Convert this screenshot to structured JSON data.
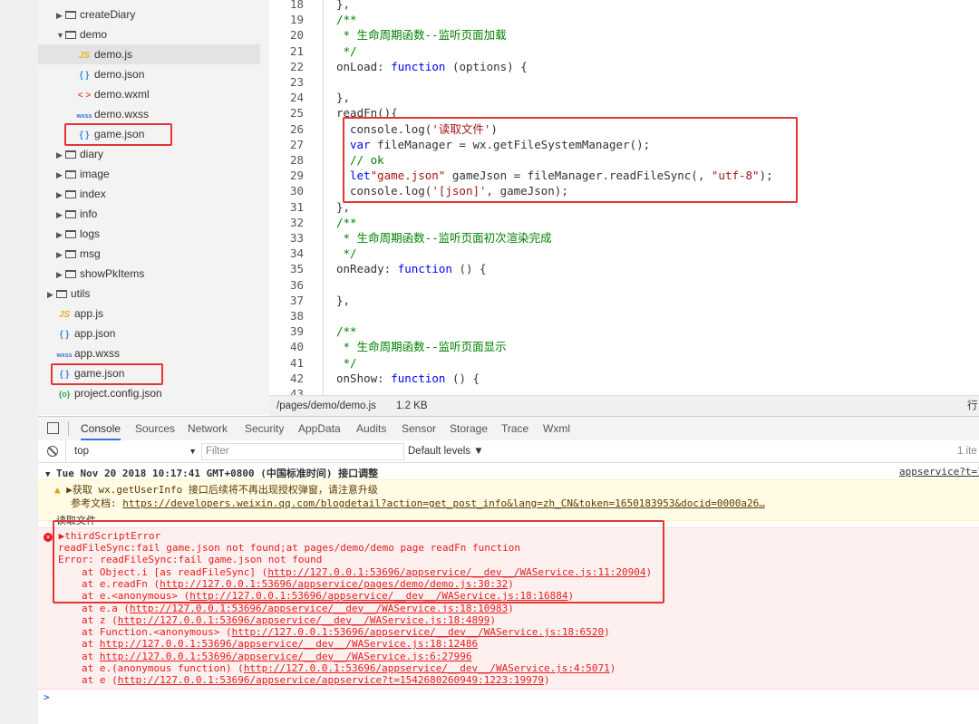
{
  "file_tree": {
    "items": [
      {
        "label": "createDiary",
        "kind": "folder",
        "expanded": false
      },
      {
        "label": "demo",
        "kind": "folder",
        "expanded": true
      },
      {
        "label": "demo.js",
        "kind": "js",
        "icon": "JS"
      },
      {
        "label": "demo.json",
        "kind": "json",
        "icon": "{ }"
      },
      {
        "label": "demo.wxml",
        "kind": "wxml",
        "icon": "< >"
      },
      {
        "label": "demo.wxss",
        "kind": "wxss",
        "icon": "wxss"
      },
      {
        "label": "game.json",
        "kind": "json",
        "icon": "{ }"
      },
      {
        "label": "diary",
        "kind": "folder",
        "expanded": false
      },
      {
        "label": "image",
        "kind": "folder",
        "expanded": false
      },
      {
        "label": "index",
        "kind": "folder",
        "expanded": false
      },
      {
        "label": "info",
        "kind": "folder",
        "expanded": false
      },
      {
        "label": "logs",
        "kind": "folder",
        "expanded": false
      },
      {
        "label": "msg",
        "kind": "folder",
        "expanded": false
      },
      {
        "label": "showPkItems",
        "kind": "folder",
        "expanded": false
      },
      {
        "label": "utils",
        "kind": "folder",
        "expanded": false
      },
      {
        "label": "app.js",
        "kind": "js",
        "icon": "JS"
      },
      {
        "label": "app.json",
        "kind": "json",
        "icon": "{ }"
      },
      {
        "label": "app.wxss",
        "kind": "wxss",
        "icon": "wxss"
      },
      {
        "label": "game.json",
        "kind": "json",
        "icon": "{ }"
      },
      {
        "label": "project.config.json",
        "kind": "cfg",
        "icon": "{o}"
      }
    ]
  },
  "editor": {
    "lines": [
      {
        "n": "18",
        "text": "},"
      },
      {
        "n": "19",
        "text": "/**"
      },
      {
        "n": "20",
        "text": " * 生命周期函数--监听页面加载"
      },
      {
        "n": "21",
        "text": " */"
      },
      {
        "n": "22",
        "a": "onLoad: ",
        "b": "function",
        "c": " (options) {"
      },
      {
        "n": "23",
        "text": ""
      },
      {
        "n": "24",
        "text": "},"
      },
      {
        "n": "25",
        "text": "readFn(){"
      },
      {
        "n": "26",
        "a": "console.log(",
        "s": "'读取文件'",
        "c": ")"
      },
      {
        "n": "27",
        "b": "var",
        "c": " fileManager = wx.getFileSystemManager();"
      },
      {
        "n": "28",
        "text": "// ok"
      },
      {
        "n": "29",
        "b": "let",
        "c": " gameJson = fileManager.readFileSync(",
        "s": "\"game.json\"",
        "d": ", ",
        "s2": "\"utf-8\"",
        "e": ");"
      },
      {
        "n": "30",
        "a": "console.log(",
        "s": "'[json]'",
        "c": ", gameJson);"
      },
      {
        "n": "31",
        "text": "},"
      },
      {
        "n": "32",
        "text": "/**"
      },
      {
        "n": "33",
        "text": " * 生命周期函数--监听页面初次渲染完成"
      },
      {
        "n": "34",
        "text": " */"
      },
      {
        "n": "35",
        "a": "onReady: ",
        "b": "function",
        "c": " () {"
      },
      {
        "n": "36",
        "text": ""
      },
      {
        "n": "37",
        "text": "},"
      },
      {
        "n": "38",
        "text": ""
      },
      {
        "n": "39",
        "text": "/**"
      },
      {
        "n": "40",
        "text": " * 生命周期函数--监听页面显示"
      },
      {
        "n": "41",
        "text": " */"
      },
      {
        "n": "42",
        "a": "onShow: ",
        "b": "function",
        "c": " () {"
      },
      {
        "n": "43",
        "text": ""
      }
    ]
  },
  "statusbar": {
    "path": "/pages/demo/demo.js",
    "size": "1.2 KB",
    "right": "行"
  },
  "devtools": {
    "tabs": [
      "Console",
      "Sources",
      "Network",
      "Security",
      "AppData",
      "Audits",
      "Sensor",
      "Storage",
      "Trace",
      "Wxml"
    ],
    "active_tab": "Console"
  },
  "filterbar": {
    "context": "top",
    "filter_placeholder": "Filter",
    "levels": "Default levels ▼",
    "count": "1 ite"
  },
  "console": {
    "group_header": "Tue Nov 20 2018 10:17:41 GMT+0800 (中国标准时间) 接口调整",
    "group_source": "appservice?t=1",
    "warn_line1": "▶获取 wx.getUserInfo 接口后续将不再出现授权弹窗，请注意升级",
    "warn_line2_prefix": "参考文档: ",
    "warn_line2_link": "https://developers.weixin.qq.com/blogdetail?action=get_post_info&lang=zh_CN&token=1650183953&docid=0000a26…",
    "log_line": "读取文件",
    "error_title": "▶thirdScriptError",
    "error_lines": [
      {
        "text": "readFileSync:fail game.json not found;at pages/demo/demo page readFn function",
        "indent": 0
      },
      {
        "text": "Error: readFileSync:fail game.json not found",
        "indent": 0
      },
      {
        "pre": "at Object.i [as readFileSync] (",
        "link": "http://127.0.0.1:53696/appservice/__dev__/WAService.js:11:20904",
        "post": ")",
        "indent": 1
      },
      {
        "pre": "at e.readFn (",
        "link": "http://127.0.0.1:53696/appservice/pages/demo/demo.js:30:32",
        "post": ")",
        "indent": 1
      },
      {
        "pre": "at e.<anonymous> (",
        "link": "http://127.0.0.1:53696/appservice/__dev__/WAService.js:18:16884",
        "post": ")",
        "indent": 1
      },
      {
        "pre": "at e.a (",
        "link": "http://127.0.0.1:53696/appservice/__dev__/WAService.js:18:10983",
        "post": ")",
        "indent": 1
      },
      {
        "pre": "at z (",
        "link": "http://127.0.0.1:53696/appservice/__dev__/WAService.js:18:4899",
        "post": ")",
        "indent": 1
      },
      {
        "pre": "at Function.<anonymous> (",
        "link": "http://127.0.0.1:53696/appservice/__dev__/WAService.js:18:6520",
        "post": ")",
        "indent": 1
      },
      {
        "pre": "at ",
        "link": "http://127.0.0.1:53696/appservice/__dev__/WAService.js:18:12486",
        "post": "",
        "indent": 1
      },
      {
        "pre": "at ",
        "link": "http://127.0.0.1:53696/appservice/__dev__/WAService.js:6:27996",
        "post": "",
        "indent": 1
      },
      {
        "pre": "at e.(anonymous function) (",
        "link": "http://127.0.0.1:53696/appservice/__dev__/WAService.js:4:5071",
        "post": ")",
        "indent": 1
      },
      {
        "pre": "at e (",
        "link": "http://127.0.0.1:53696/appservice/appservice?t=1542680260949:1223:19979",
        "post": ")",
        "indent": 1
      }
    ],
    "prompt": ">"
  },
  "colors": {
    "highlight_box": "#e23636",
    "error_text": "#e41e1e",
    "keyword": "#0000ff",
    "comment": "#008000",
    "string": "#a31515"
  }
}
